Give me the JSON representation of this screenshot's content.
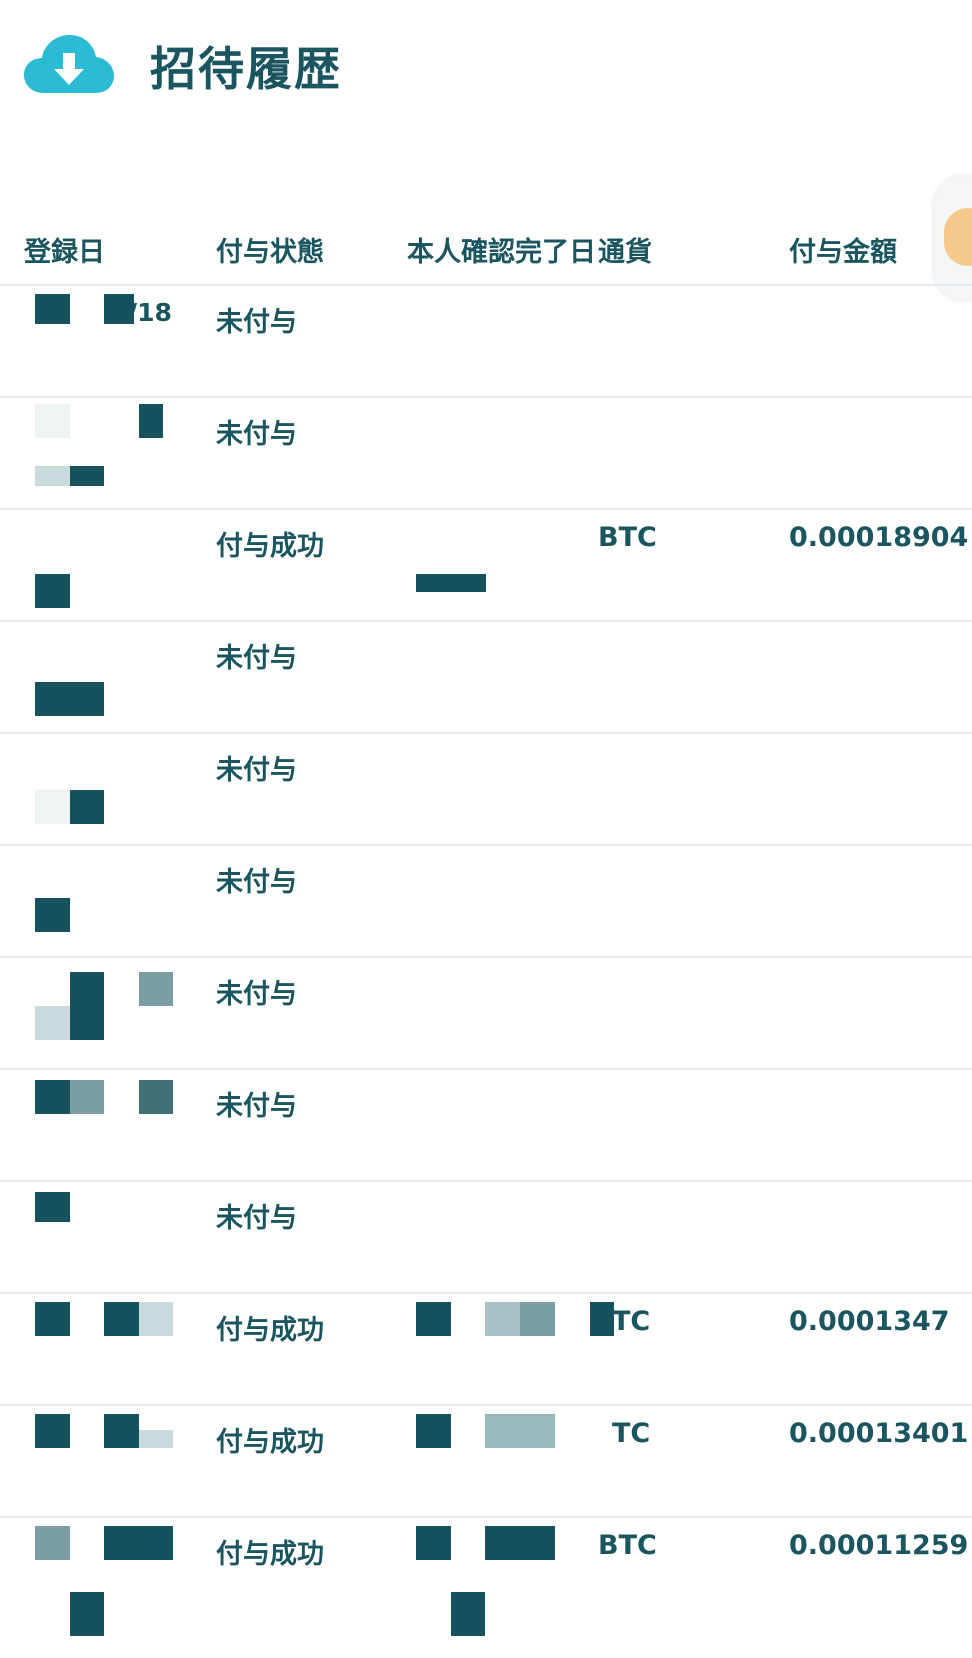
{
  "page": {
    "title": "招待履歴",
    "header_icon": "cloud-download-icon",
    "accent_color": "#2bbbd4",
    "text_color": "#1a5560"
  },
  "table": {
    "columns": [
      {
        "key": "registered",
        "label": "登録日"
      },
      {
        "key": "status",
        "label": "付与状態"
      },
      {
        "key": "verified",
        "label": "本人確認完了日"
      },
      {
        "key": "currency",
        "label": "通貨"
      },
      {
        "key": "amount",
        "label": "付与金額"
      }
    ],
    "rows": [
      {
        "registered": "/18",
        "status": "未付与",
        "verified": "",
        "currency": "",
        "amount": ""
      },
      {
        "registered": "",
        "status": "未付与",
        "verified": "",
        "currency": "",
        "amount": ""
      },
      {
        "registered": "",
        "status": "付与成功",
        "verified": "",
        "currency": "BTC",
        "amount": "0.00018904"
      },
      {
        "registered": "",
        "status": "未付与",
        "verified": "",
        "currency": "",
        "amount": ""
      },
      {
        "registered": "",
        "status": "未付与",
        "verified": "",
        "currency": "",
        "amount": ""
      },
      {
        "registered": "",
        "status": "未付与",
        "verified": "",
        "currency": "",
        "amount": ""
      },
      {
        "registered": "",
        "status": "未付与",
        "verified": "",
        "currency": "",
        "amount": ""
      },
      {
        "registered": "",
        "status": "未付与",
        "verified": "",
        "currency": "",
        "amount": ""
      },
      {
        "registered": "",
        "status": "未付与",
        "verified": "",
        "currency": "",
        "amount": ""
      },
      {
        "registered": "",
        "status": "付与成功",
        "verified": "",
        "currency": "TC",
        "amount": "0.0001347"
      },
      {
        "registered": "",
        "status": "付与成功",
        "verified": "",
        "currency": "TC",
        "amount": "0.00013401"
      },
      {
        "registered": "",
        "status": "付与成功",
        "verified": "",
        "currency": "BTC",
        "amount": "0.00011259"
      }
    ]
  }
}
